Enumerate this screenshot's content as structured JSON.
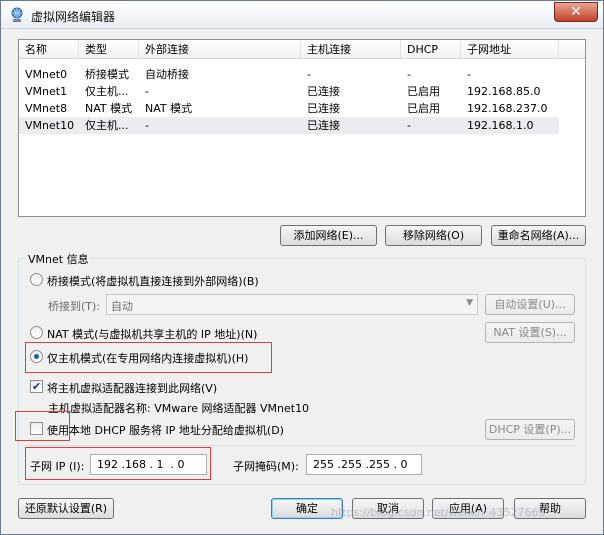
{
  "window": {
    "title": "虚拟网络编辑器",
    "close_label": "✕"
  },
  "network_list": {
    "columns": [
      "名称",
      "类型",
      "外部连接",
      "主机连接",
      "DHCP",
      "子网地址"
    ],
    "rows": [
      [
        "VMnet0",
        "桥接模式",
        "自动桥接",
        "-",
        "-",
        "-"
      ],
      [
        "VMnet1",
        "仅主机...",
        "-",
        "已连接",
        "已启用",
        "192.168.85.0"
      ],
      [
        "VMnet8",
        "NAT 模式",
        "NAT 模式",
        "已连接",
        "已启用",
        "192.168.237.0"
      ],
      [
        "VMnet10",
        "仅主机...",
        "-",
        "已连接",
        "-",
        "192.168.1.0"
      ]
    ],
    "selected_row": 3
  },
  "list_buttons": {
    "add": "添加网络(E)...",
    "remove": "移除网络(O)",
    "rename": "重命名网络(A)..."
  },
  "vmnet_info": {
    "title": "VMnet 信息",
    "bridged_radio": "桥接模式(将虚拟机直接连接到外部网络)(B)",
    "bridged_to_label": "桥接到(T):",
    "bridged_to_value": "自动",
    "auto_settings": "自动设置(U)...",
    "nat_radio": "NAT 模式(与虚拟机共享主机的 IP 地址)(N)",
    "nat_settings": "NAT 设置(S)...",
    "hostonly_radio": "仅主机模式(在专用网络内连接虚拟机)(H)",
    "selected_mode": "hostonly",
    "connect_adapter_checkbox": "将主机虚拟适配器连接到此网络(V)",
    "connect_adapter_checked": true,
    "adapter_name_text": "主机虚拟适配器名称: VMware 网络适配器 VMnet10",
    "dhcp_checkbox": "使用本地 DHCP 服务将 IP 地址分配给虚拟机(D)",
    "dhcp_checked": false,
    "dhcp_settings": "DHCP 设置(P)...",
    "subnet_ip_label": "子网 IP (I):",
    "subnet_ip_value": "192 .168 . 1  . 0",
    "subnet_mask_label": "子网掩码(M):",
    "subnet_mask_value": "255 .255 .255 . 0"
  },
  "footer_buttons": {
    "restore_defaults": "还原默认设置(R)",
    "ok": "确定",
    "cancel": "取消",
    "apply": "应用(A)",
    "help": "帮助"
  },
  "watermark": "https://blog.csdn.net/weixin_43527665",
  "colors": {
    "highlight_box": "#e23b3b",
    "selected_row": "#ececf0",
    "default_button_border": "#3c7fb1"
  }
}
